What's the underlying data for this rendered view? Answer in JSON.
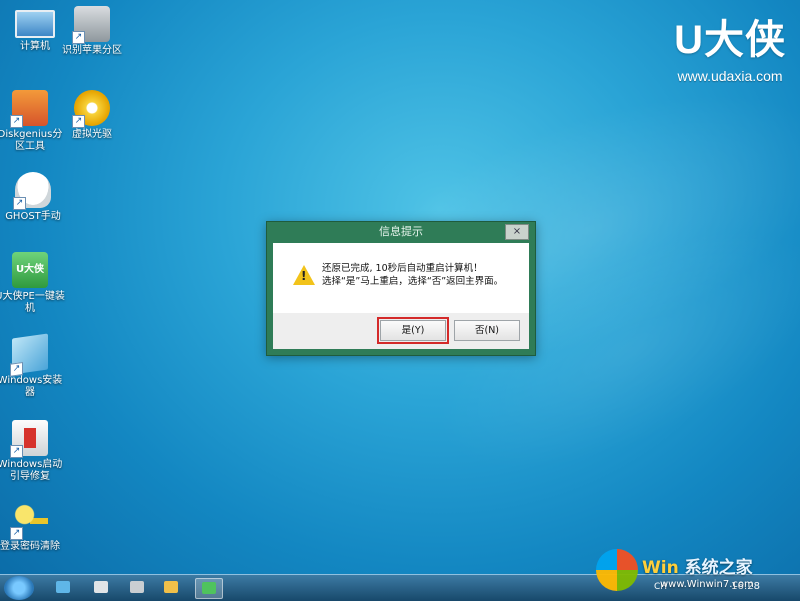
{
  "brand": {
    "logo": "U大侠",
    "url": "www.udaxia.com"
  },
  "desktop_icons": [
    {
      "label": "计算机",
      "icon": "computer-icon"
    },
    {
      "label": "识别苹果分区",
      "icon": "disk-drive-icon"
    },
    {
      "label": "Diskgenius分区工具",
      "icon": "diskgenius-icon"
    },
    {
      "label": "虚拟光驱",
      "icon": "cd-icon"
    },
    {
      "label": "GHOST手动",
      "icon": "ghost-icon"
    },
    {
      "label": "U大侠PE一键装机",
      "icon": "udaxia-usb-icon",
      "icon_text": "U大侠"
    },
    {
      "label": "Windows安装器",
      "icon": "windows-installer-icon"
    },
    {
      "label": "Windows启动引导修复",
      "icon": "toolbox-icon"
    },
    {
      "label": "登录密码清除",
      "icon": "key-icon"
    }
  ],
  "dialog": {
    "title": "信息提示",
    "close": "×",
    "message_line1": "还原已完成, 10秒后自动重启计算机！",
    "message_line2": "选择“是”马上重启，选择“否”返回主界面。",
    "yes_label": "是(Y)",
    "no_label": "否(N)"
  },
  "taskbar": {
    "tray_lang": "CH",
    "clock": "16:28"
  },
  "watermark": {
    "text": "系统之家",
    "win_label": "Win",
    "url": "www.Winwin7.com"
  },
  "colors": {
    "dialog_frame": "#2f7c57",
    "highlight": "#d42a2a",
    "desktop": "#2aa4d6"
  }
}
